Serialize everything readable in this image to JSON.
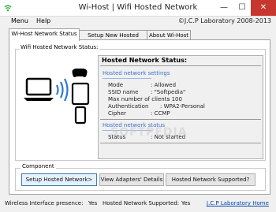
{
  "window": {
    "title": "Wi-Host | Wifi Hosted Network",
    "controls": {
      "minimize": "—",
      "maximize": "☐",
      "close": "✕"
    }
  },
  "menu": {
    "items": [
      "Menu",
      "Help"
    ],
    "copyright": "©J.C.P Laboratory 2008-2013"
  },
  "tabs": [
    {
      "label": "Wi-Host Network Status",
      "active": true
    },
    {
      "label": "Setup New Hosted Network",
      "active": false
    },
    {
      "label": "About Wi-Host",
      "active": false
    }
  ],
  "status_panel": {
    "group_label": "Wifi Hosted Network Status:",
    "heading": "Hosted Network Status:",
    "settings_title": "Hosted network settings",
    "settings": [
      {
        "key": "Mode",
        "value": ": Allowed"
      },
      {
        "key": "SSID name",
        "value": ": \"Softpedia\""
      },
      {
        "key": "Max number of clients",
        "value": ": 100"
      },
      {
        "key": "Authentication",
        "value": ": WPA2-Personal"
      },
      {
        "key": "Cipher",
        "value": ": CCMP"
      }
    ],
    "status_title": "Hosted network status",
    "status": [
      {
        "key": "Status",
        "value": ": Not started"
      }
    ],
    "watermark": "SOFTPEDIA"
  },
  "component": {
    "label": "Component",
    "buttons": [
      "Setup Hosted Network>",
      "View Adapters' Details",
      "Hosted Network Supported?"
    ]
  },
  "statusbar": {
    "wireless_label": "Wireless Interface presence:",
    "wireless_value": "Yes",
    "supported_label": "Hosted Network Supported:",
    "supported_value": "Yes",
    "home_link": "J.C.P Laboratory Home"
  },
  "colors": {
    "accent": "#3a6fd0",
    "close": "#c7372f",
    "link": "#0645ad"
  },
  "icons": [
    "wifi-app-icon",
    "laptop-icon",
    "wireless-signal-icon",
    "gamepad-icon",
    "phone-icon",
    "tablet-icon"
  ]
}
